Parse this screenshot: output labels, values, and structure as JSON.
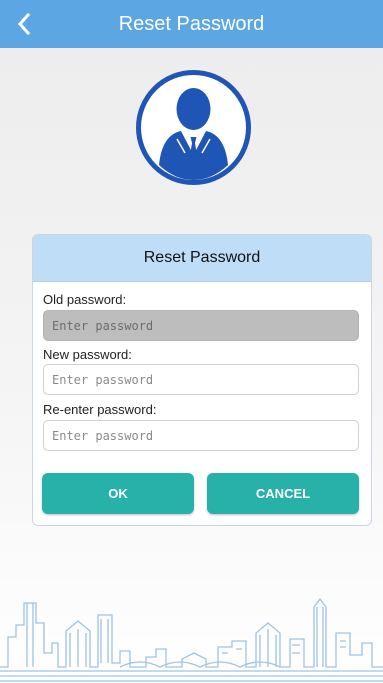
{
  "header": {
    "title": "Reset Password",
    "back_icon": "chevron-left-icon"
  },
  "avatar": {
    "icon": "user-businessman-icon"
  },
  "card": {
    "title": "Reset Password",
    "old_password": {
      "label": "Old password:",
      "placeholder": "Enter password",
      "disabled": true
    },
    "new_password": {
      "label": "New password:",
      "placeholder": "Enter password"
    },
    "reenter_password": {
      "label": "Re-enter password:",
      "placeholder": "Enter password"
    },
    "ok_label": "OK",
    "cancel_label": "CANCEL"
  },
  "colors": {
    "header_bg": "#5ba6e3",
    "card_head_bg": "#c0ddf8",
    "button_bg": "#28b1a8",
    "avatar_blue": "#1f56b5",
    "skyline": "#9ec3e6"
  }
}
